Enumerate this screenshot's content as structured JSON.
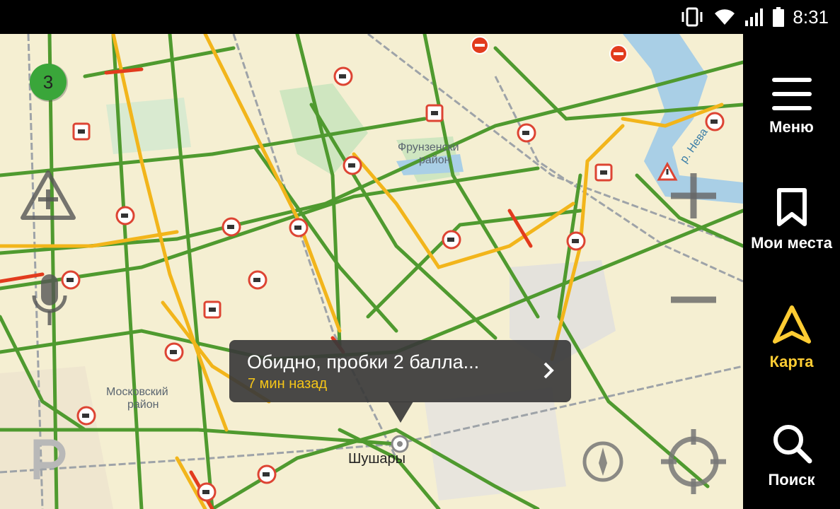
{
  "status_bar": {
    "time": "8:31",
    "icons": [
      "vibrate-icon",
      "wifi-icon",
      "signal-icon",
      "battery-icon"
    ]
  },
  "traffic_badge": {
    "value": "3",
    "color": "#3aa63a"
  },
  "map_labels": {
    "district_frunzensky_1": "Фрунзенски",
    "district_frunzensky_2": "район",
    "district_moskovsky_1": "Московский",
    "district_moskovsky_2": "район",
    "place_shushary": "Шушары",
    "river_neva": "р. Нева"
  },
  "toast": {
    "message": "Обидно, пробки 2 балла...",
    "time_ago": "7 мин назад"
  },
  "sidebar": {
    "items": [
      {
        "label": "Меню",
        "icon": "hamburger-menu-icon"
      },
      {
        "label": "Мои места",
        "icon": "bookmark-icon"
      },
      {
        "label": "Карта",
        "icon": "navigation-arrow-icon",
        "active": true
      },
      {
        "label": "Поиск",
        "icon": "search-icon"
      }
    ]
  },
  "controls": [
    "report-event-button",
    "voice-button",
    "parking-button",
    "zoom-in-button",
    "zoom-out-button",
    "compass-button",
    "locate-me-button"
  ],
  "colors": {
    "accent": "#ffcc33",
    "traffic_green": "#4f9a2f",
    "traffic_yellow": "#f2b51b",
    "traffic_red": "#e23b1d",
    "map_bg": "#f5efd2"
  }
}
